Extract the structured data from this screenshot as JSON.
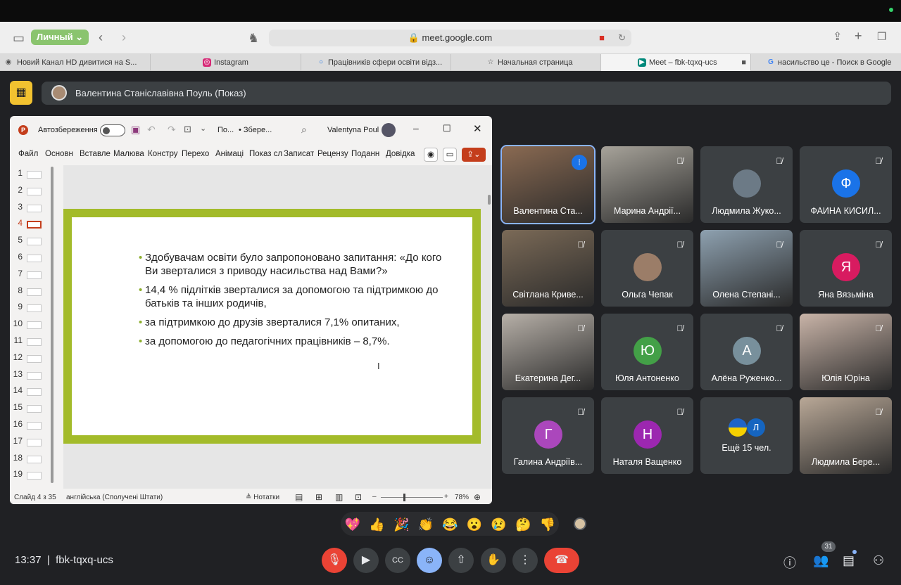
{
  "browser": {
    "profile": "Личный",
    "url": "meet.google.com",
    "tabs": [
      {
        "title": "Новий Канал HD дивитися на S..."
      },
      {
        "title": "Instagram"
      },
      {
        "title": "Працівників сфери освіти відз..."
      },
      {
        "title": "Начальная страница"
      },
      {
        "title": "Meet – fbk-tqxq-ucs"
      },
      {
        "title": "насильство це - Поиск в Google"
      }
    ]
  },
  "presenter_bar": {
    "text": "Валентина Станіславівна Поуль (Показ)"
  },
  "ppt": {
    "autosave_label": "Автозбереження",
    "file_short": "По...",
    "saved_status": "• Збере...",
    "user": "Valentyna Poul",
    "ribbon": [
      "Файл",
      "Основне",
      "Вставлення",
      "Малювання",
      "Конструктор",
      "Переходи",
      "Анімація",
      "Показ слайдів",
      "Записати",
      "Рецензування",
      "Подання",
      "Довідка"
    ],
    "ribbon_visible": [
      "Файл",
      "Основн",
      "Вставле",
      "Малюва",
      "Констру",
      "Перехо",
      "Анімаці",
      "Показ сл",
      "Записат",
      "Рецензу",
      "Поданн",
      "Довідка"
    ],
    "slide_numbers": [
      "1",
      "2",
      "3",
      "4",
      "5",
      "6",
      "7",
      "8",
      "9",
      "10",
      "11",
      "12",
      "13",
      "14",
      "15",
      "16",
      "17",
      "18",
      "19"
    ],
    "current_slide": "4",
    "bullets": [
      "Здобувачам освіти було запропоновано запитання: «До кого Ви зверталися з приводу насильства над Вами?»",
      "14,4 % підлітків зверталися за допомогою та підтримкою до батьків та інших родичів,",
      "за підтримкою до друзів зверталися 7,1% опитаних,",
      "за допомогою до педагогічних працівників – 8,7%."
    ],
    "status_slide": "Слайд 4 з 35",
    "status_lang": "англійська (Сполучені Штати)",
    "notes_label": "Нотатки",
    "zoom": "78%"
  },
  "participants": [
    {
      "name": "Валентина Ста...",
      "type": "photo",
      "color": "#8a6a52",
      "muted": false,
      "speaking": true
    },
    {
      "name": "Марина Андрії...",
      "type": "photo",
      "color": "#a7a39a",
      "muted": true
    },
    {
      "name": "Людмила Жуко...",
      "type": "avatar-photo",
      "color": "#6c7a86",
      "muted": true
    },
    {
      "name": "ФАИНА КИСИЛ...",
      "type": "letter",
      "letter": "Ф",
      "color": "#1a73e8",
      "muted": true
    },
    {
      "name": "Світлана Криве...",
      "type": "photo",
      "color": "#7b6a57",
      "muted": true
    },
    {
      "name": "Ольга Чепак",
      "type": "avatar-photo",
      "color": "#9b7d68",
      "muted": true
    },
    {
      "name": "Олена Степані...",
      "type": "photo",
      "color": "#8ea1b0",
      "muted": true
    },
    {
      "name": "Яна Вязьміна",
      "type": "letter",
      "letter": "Я",
      "color": "#d81b60",
      "muted": true
    },
    {
      "name": "Екатерина Дег...",
      "type": "photo",
      "color": "#b7b0a8",
      "muted": true
    },
    {
      "name": "Юля Антоненко",
      "type": "letter",
      "letter": "Ю",
      "color": "#43a047",
      "muted": true
    },
    {
      "name": "Алёна Руженко...",
      "type": "letter",
      "letter": "А",
      "color": "#78909c",
      "muted": true
    },
    {
      "name": "Юлія Юріна",
      "type": "photo",
      "color": "#c9b4a8",
      "muted": true
    },
    {
      "name": "Галина Андріїв...",
      "type": "letter",
      "letter": "Г",
      "color": "#ab47bc",
      "muted": true
    },
    {
      "name": "Наталя Ващенко",
      "type": "letter",
      "letter": "Н",
      "color": "#9c27b0",
      "muted": true
    },
    {
      "name": "Ещё 15 чел.",
      "type": "more",
      "letter": "Л",
      "color": "#1565c0",
      "muted": false
    },
    {
      "name": "Людмила Бере...",
      "type": "photo",
      "color": "#b9a897",
      "muted": true
    }
  ],
  "reactions": [
    "💖",
    "👍",
    "🎉",
    "👏",
    "😂",
    "😮",
    "😢",
    "🤔",
    "👎"
  ],
  "meeting": {
    "time": "13:37",
    "separator": "|",
    "code": "fbk-tqxq-ucs",
    "participant_count": "31"
  }
}
